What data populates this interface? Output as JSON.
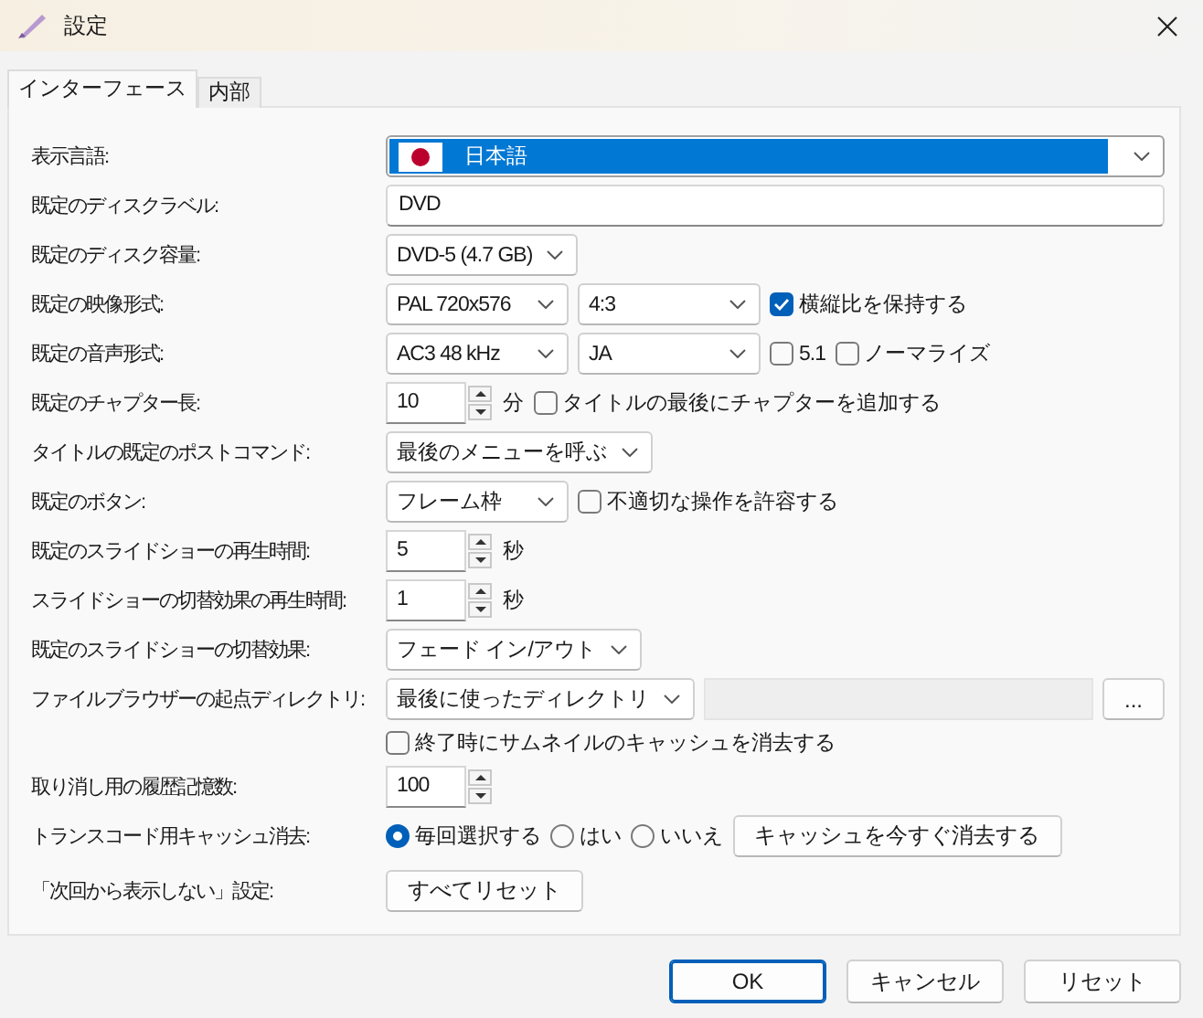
{
  "window": {
    "title": "設定"
  },
  "tabs": [
    {
      "label": "インターフェース",
      "selected": true
    },
    {
      "label": "内部",
      "selected": false
    }
  ],
  "rows": [
    {
      "label": "表示言語:",
      "controls": [
        {
          "kind": "language",
          "value": "日本語"
        }
      ]
    },
    {
      "label": "既定のディスクラベル:",
      "controls": [
        {
          "kind": "text",
          "value": "DVD"
        }
      ]
    },
    {
      "label": "既定のディスク容量:",
      "controls": [
        {
          "kind": "dropdown",
          "value": "DVD-5 (4.7 GB)"
        }
      ]
    },
    {
      "label": "既定の映像形式:",
      "controls": [
        {
          "kind": "dropdown",
          "value": "PAL 720x576"
        },
        {
          "kind": "dropdown",
          "value": "4:3"
        },
        {
          "kind": "checkbox",
          "label": "横縦比を保持する",
          "checked": true
        }
      ]
    },
    {
      "label": "既定の音声形式:",
      "controls": [
        {
          "kind": "dropdown",
          "value": "AC3 48 kHz"
        },
        {
          "kind": "dropdown",
          "value": "JA"
        },
        {
          "kind": "checkbox",
          "label": "5.1",
          "checked": false
        },
        {
          "kind": "checkbox",
          "label": "ノーマライズ",
          "checked": false
        }
      ]
    },
    {
      "label": "既定のチャプター長:",
      "controls": [
        {
          "kind": "spin",
          "value": "10"
        },
        {
          "kind": "unit",
          "text": "分"
        },
        {
          "kind": "checkbox",
          "label": "タイトルの最後にチャプターを追加する",
          "checked": false
        }
      ]
    },
    {
      "label": "タイトルの既定のポストコマンド:",
      "controls": [
        {
          "kind": "dropdown",
          "value": "最後のメニューを呼ぶ"
        }
      ]
    },
    {
      "label": "既定のボタン:",
      "controls": [
        {
          "kind": "dropdown",
          "value": "フレーム枠"
        },
        {
          "kind": "checkbox",
          "label": "不適切な操作を許容する",
          "checked": false
        }
      ]
    },
    {
      "label": "既定のスライドショーの再生時間:",
      "controls": [
        {
          "kind": "spin",
          "value": "5"
        },
        {
          "kind": "unit",
          "text": "秒"
        }
      ]
    },
    {
      "label": "スライドショーの切替効果の再生時間:",
      "controls": [
        {
          "kind": "spin",
          "value": "1"
        },
        {
          "kind": "unit",
          "text": "秒"
        }
      ]
    },
    {
      "label": "既定のスライドショーの切替効果:",
      "controls": [
        {
          "kind": "dropdown",
          "value": "フェード イン/アウト"
        }
      ]
    },
    {
      "label": "ファイルブラウザーの起点ディレクトリ:",
      "controls": [
        {
          "kind": "dropdown",
          "value": "最後に使ったディレクトリ"
        },
        {
          "kind": "path",
          "disabled": true
        },
        {
          "kind": "button",
          "label": "..."
        }
      ]
    },
    {
      "controls": [
        {
          "kind": "checkbox",
          "label": "終了時にサムネイルのキャッシュを消去する",
          "checked": false
        }
      ]
    },
    {
      "label": "取り消し用の履歴記憶数:",
      "controls": [
        {
          "kind": "spin",
          "value": "100"
        }
      ]
    },
    {
      "label": "トランスコード用キャッシュ消去:",
      "controls": [
        {
          "kind": "radio",
          "label": "毎回選択する",
          "selected": true
        },
        {
          "kind": "radio",
          "label": "はい",
          "selected": false
        },
        {
          "kind": "radio",
          "label": "いいえ",
          "selected": false
        },
        {
          "kind": "button",
          "label": "キャッシュを今すぐ消去する"
        }
      ]
    },
    {
      "label": "「次回から表示しない」設定:",
      "controls": [
        {
          "kind": "button",
          "label": "すべてリセット"
        }
      ]
    }
  ],
  "buttons": [
    {
      "label": "OK",
      "default": true
    },
    {
      "label": "キャンセル",
      "default": false
    },
    {
      "label": "リセット",
      "default": false
    }
  ]
}
